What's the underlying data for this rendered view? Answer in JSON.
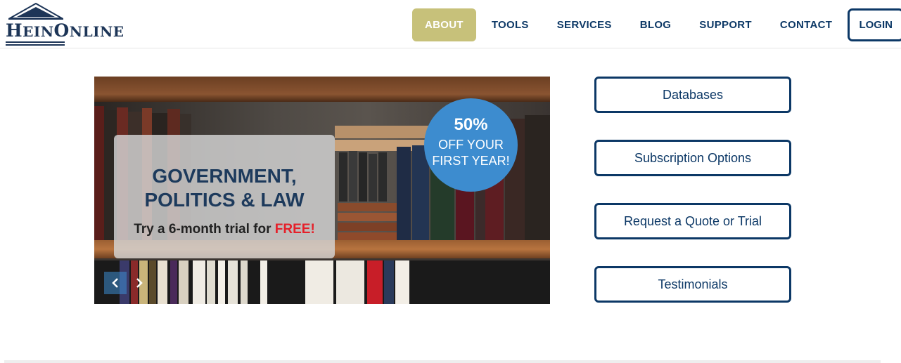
{
  "brand": {
    "logo_text_big1": "H",
    "logo_text_small1": "EIN",
    "logo_text_big2": "O",
    "logo_text_small2": "NLINE"
  },
  "nav": {
    "items": [
      {
        "label": "ABOUT",
        "active": true
      },
      {
        "label": "TOOLS"
      },
      {
        "label": "SERVICES"
      },
      {
        "label": "BLOG"
      },
      {
        "label": "SUPPORT"
      },
      {
        "label": "CONTACT"
      }
    ],
    "login_label": "LOGIN"
  },
  "hero": {
    "title_line1": "GOVERNMENT,",
    "title_line2": "POLITICS & LAW",
    "subtitle_prefix": "Try a 6-month trial for ",
    "subtitle_highlight": "FREE!",
    "badge_pct": "50%",
    "badge_line1": "OFF YOUR",
    "badge_line2": "FIRST YEAR!",
    "prev_icon": "chevron-left-icon",
    "next_icon": "chevron-right-icon"
  },
  "side_buttons": [
    {
      "label": "Databases"
    },
    {
      "label": "Subscription Options"
    },
    {
      "label": "Request a Quote or Trial"
    },
    {
      "label": "Testimonials"
    }
  ],
  "colors": {
    "navy": "#0c3866",
    "active_nav": "#c7c17a",
    "badge_blue": "#3d8ccf",
    "free_red": "#e5202a"
  }
}
